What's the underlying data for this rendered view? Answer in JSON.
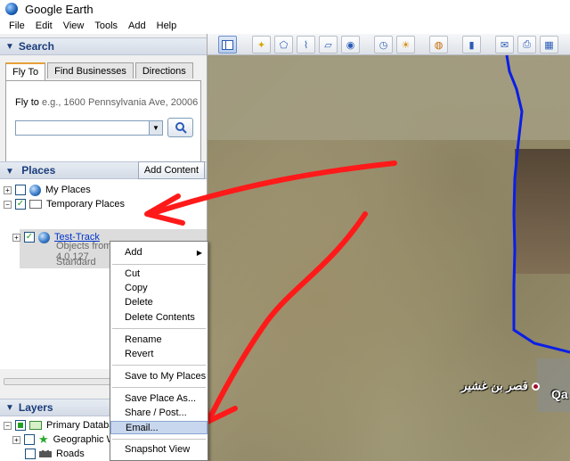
{
  "window": {
    "title": "Google Earth"
  },
  "menubar": [
    "File",
    "Edit",
    "View",
    "Tools",
    "Add",
    "Help"
  ],
  "search": {
    "header": "Search",
    "tabs": [
      "Fly To",
      "Find Businesses",
      "Directions"
    ],
    "fly_label": "Fly to",
    "fly_placeholder": "e.g., 1600 Pennsylvania Ave, 20006",
    "input_value": ""
  },
  "places": {
    "header": "Places",
    "add_content": "Add Content",
    "items": {
      "my_places": "My Places",
      "temporary_places": "Temporary Places",
      "test_track": "Test-Track",
      "test_track_desc1": "Objects from Touratech QV 4.0.127",
      "test_track_desc2": "Standard"
    }
  },
  "layers": {
    "header": "Layers",
    "items": {
      "primary": "Primary Databas",
      "geographic": "Geographic W",
      "roads": "Roads"
    }
  },
  "context_menu": {
    "add": "Add",
    "cut": "Cut",
    "copy": "Copy",
    "delete": "Delete",
    "delete_contents": "Delete Contents",
    "rename": "Rename",
    "revert": "Revert",
    "save_to_my_places": "Save to My Places",
    "save_place_as": "Save Place As...",
    "share_post": "Share / Post...",
    "email": "Email...",
    "snapshot_view": "Snapshot View"
  },
  "map": {
    "place_label": "قصر بن غشير",
    "place_label2": "Qa"
  },
  "colors": {
    "arrow": "#ff1a1a",
    "track": "#0a1ee8",
    "menu_highlight": "#c8d7ee"
  }
}
